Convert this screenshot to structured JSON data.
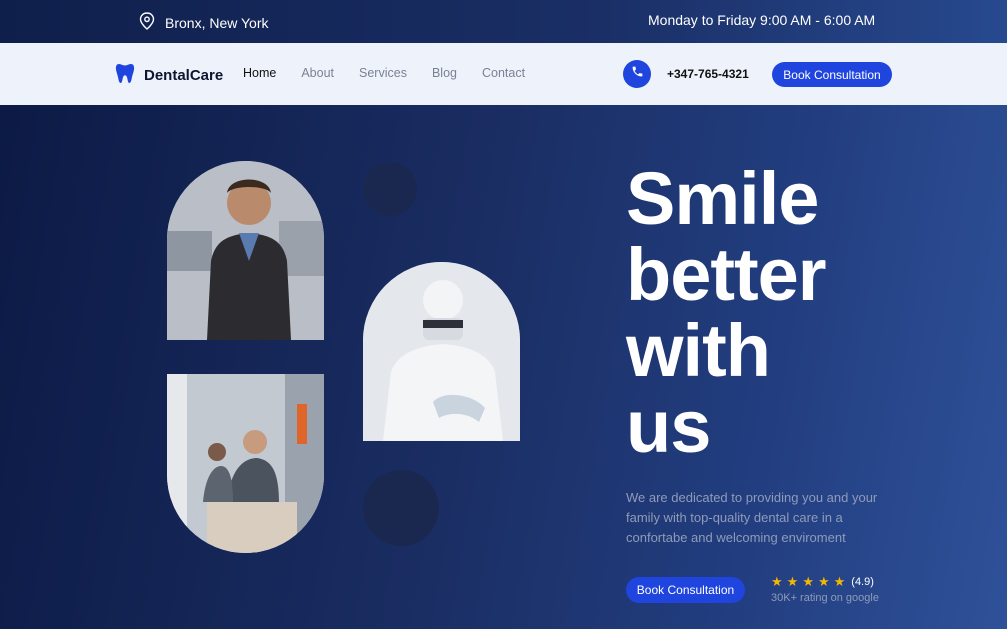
{
  "topbar": {
    "location": "Bronx, New York",
    "hours": "Monday to Friday 9:00 AM - 6:00 AM"
  },
  "nav": {
    "brand": "DentalCare",
    "items": [
      {
        "label": "Home"
      },
      {
        "label": "About"
      },
      {
        "label": "Services"
      },
      {
        "label": "Blog"
      },
      {
        "label": "Contact"
      }
    ],
    "phone": "+347-765-4321",
    "cta": "Book Consultation"
  },
  "hero": {
    "headline_lines": [
      "Smile",
      "better",
      "with",
      "us"
    ],
    "description": "We are dedicated to providing you and your family with top-quality dental care in a confortabe and welcoming enviroment",
    "cta": "Book Consultation",
    "rating": {
      "stars": 5,
      "score": "(4.9)",
      "subtitle": "30K+ rating on google"
    }
  },
  "colors": {
    "accent": "#1f45de",
    "star": "#f5b700",
    "hero_dark": "#0c1a45",
    "hero_light": "#2f5199"
  },
  "icons": [
    "location-pin-icon",
    "tooth-icon",
    "phone-icon",
    "star-icon"
  ]
}
